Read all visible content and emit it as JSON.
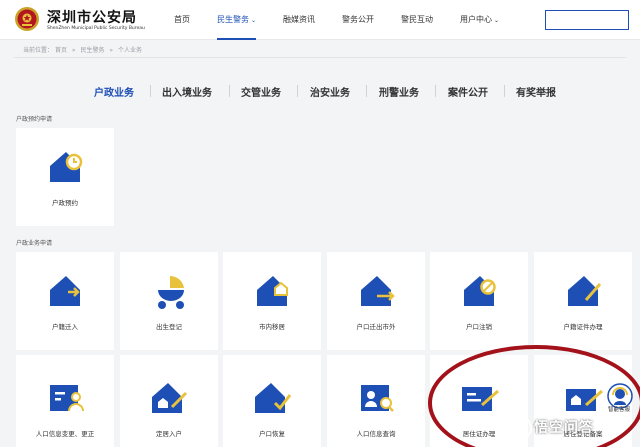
{
  "brand": {
    "name_cn": "深圳市公安局",
    "name_en": "ShenZhen Municipal Public Security Bureau"
  },
  "nav": [
    {
      "label": "首页"
    },
    {
      "label": "民生警务",
      "active": true,
      "dropdown": true
    },
    {
      "label": "融媒资讯"
    },
    {
      "label": "警务公开"
    },
    {
      "label": "警民互动"
    },
    {
      "label": "用户中心",
      "dropdown": true
    }
  ],
  "search": {
    "placeholder": ""
  },
  "breadcrumb": {
    "prefix": "当前位置：",
    "items": [
      "首页",
      "民生警务",
      "个人业务"
    ],
    "separator": "»"
  },
  "categories": [
    {
      "label": "户政业务",
      "active": true
    },
    {
      "label": "出入境业务"
    },
    {
      "label": "交管业务"
    },
    {
      "label": "治安业务"
    },
    {
      "label": "刑警业务"
    },
    {
      "label": "案件公开"
    },
    {
      "label": "有奖举报"
    }
  ],
  "sections": {
    "appointment": {
      "title": "户政预约申请",
      "cards": [
        {
          "label": "户政预约",
          "icon": "house-clock-icon"
        }
      ]
    },
    "business": {
      "title": "户政业务申请",
      "row1": [
        {
          "label": "户籍迁入",
          "icon": "house-arrow-in-icon"
        },
        {
          "label": "出生登记",
          "icon": "baby-stroller-icon"
        },
        {
          "label": "市内移居",
          "icon": "house-move-icon"
        },
        {
          "label": "户口迁出市外",
          "icon": "house-arrow-out-icon"
        },
        {
          "label": "户口注销",
          "icon": "house-cancel-icon"
        },
        {
          "label": "户籍证件办理",
          "icon": "house-pen-icon"
        }
      ],
      "row2": [
        {
          "label": "人口信息变更、更正",
          "icon": "document-person-icon"
        },
        {
          "label": "定居入户",
          "icon": "house-settle-icon"
        },
        {
          "label": "户口恢复",
          "icon": "house-check-icon"
        },
        {
          "label": "人口信息查询",
          "icon": "id-card-search-icon"
        },
        {
          "label": "居住证办理",
          "icon": "residence-card-pen-icon"
        },
        {
          "label": "居住登记备案",
          "icon": "residence-register-icon"
        }
      ]
    }
  },
  "helper": {
    "label": "智能客服",
    "icon": "headset-icon"
  },
  "watermark": {
    "text": "悟空问答",
    "icon": "wukong-icon"
  },
  "colors": {
    "primary": "#1d4fb5",
    "accent": "#e8c23b",
    "annotation": "#a3121b"
  }
}
